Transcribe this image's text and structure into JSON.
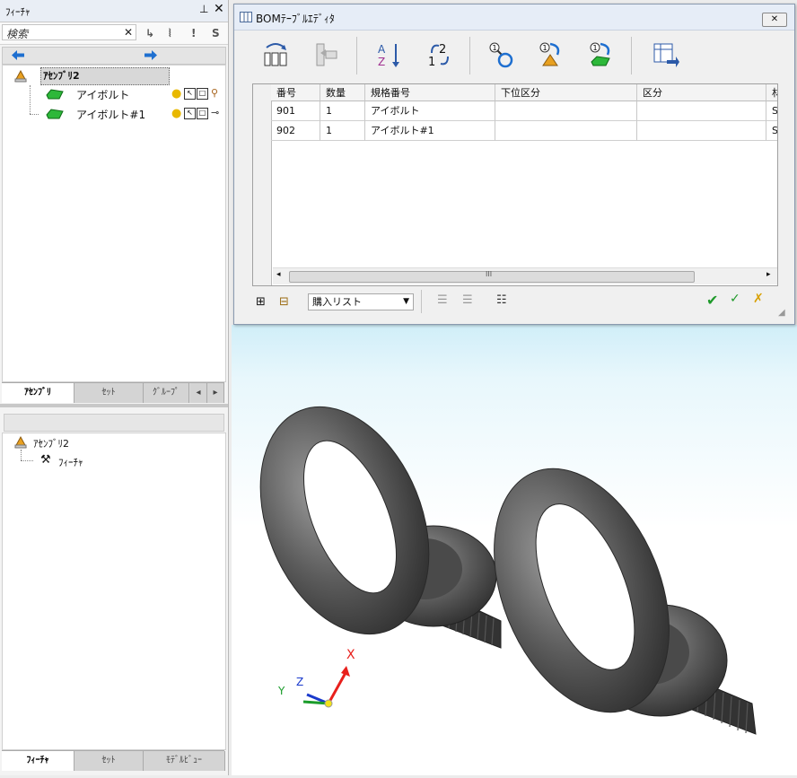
{
  "left_panel": {
    "title": "ﾌｨｰﾁｬ",
    "search_placeholder": "検索",
    "filter_icons": [
      "↳",
      "⦚",
      "!",
      "S"
    ],
    "tree_root": "ｱｾﾝﾌﾞﾘ2",
    "tree_items": [
      {
        "label": "アイボルト"
      },
      {
        "label": "アイボルト#1"
      }
    ],
    "tabs_upper": [
      "ｱｾﾝﾌﾞﾘ",
      "ｾｯﾄ",
      "ｸﾞﾙｰﾌﾟ"
    ],
    "lower_root": "ｱｾﾝﾌﾞﾘ2",
    "lower_child": "ﾌｨｰﾁｬ",
    "tabs_lower": [
      "ﾌｨｰﾁｬ",
      "ｾｯﾄ",
      "ﾓﾃﾞﾙﾋﾞｭｰ"
    ]
  },
  "bom_editor": {
    "title": "BOMﾃｰﾌﾞﾙｴﾃﾞｨﾀ",
    "columns": [
      "番号",
      "数量",
      "規格番号",
      "下位区分",
      "区分",
      "材"
    ],
    "rows": [
      [
        "901",
        "1",
        "アイボルト",
        "",
        "",
        "S"
      ],
      [
        "902",
        "1",
        "アイボルト#1",
        "",
        "",
        "S"
      ]
    ],
    "list_select": "購入リスト",
    "scroll_marker": "III",
    "accent_ok": "#1f9a2a"
  },
  "viewport": {
    "axis_labels": {
      "x": "X",
      "y": "Y",
      "z": "Z"
    },
    "colors": {
      "x": "#e8201c",
      "y": "#1a9c2a",
      "z": "#1a3acc"
    }
  }
}
